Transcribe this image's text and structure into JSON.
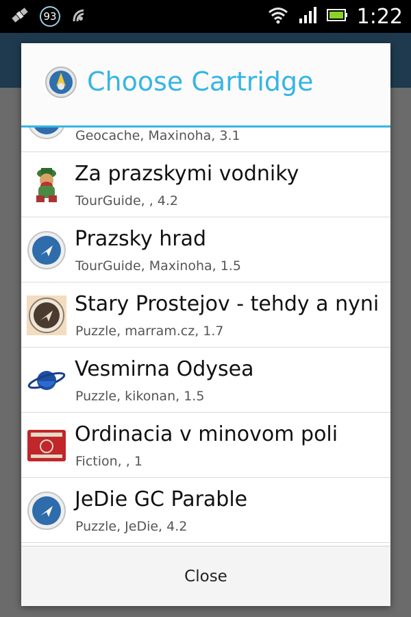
{
  "status_bar": {
    "battery_badge": "93",
    "time": "1:22"
  },
  "dialog": {
    "title": "Choose Cartridge",
    "close_label": "Close",
    "accent_color": "#35b5e5",
    "items": [
      {
        "title": "",
        "subtitle": "Geocache, Maxinoha, 3.1",
        "icon": "wherigo-compass-icon"
      },
      {
        "title": "Za prazskymi vodniky",
        "subtitle": "TourGuide, , 4.2",
        "icon": "water-goblin-icon"
      },
      {
        "title": "Prazsky hrad",
        "subtitle": "TourGuide, Maxinoha, 1.5",
        "icon": "wherigo-compass-icon"
      },
      {
        "title": "Stary Prostejov - tehdy a nyni",
        "subtitle": "Puzzle, marram.cz, 1.7",
        "icon": "sepia-compass-icon"
      },
      {
        "title": "Vesmirna Odysea",
        "subtitle": "Puzzle, kikonan, 1.5",
        "icon": "planet-icon"
      },
      {
        "title": "Ordinacia v minovom poli",
        "subtitle": "Fiction, , 1",
        "icon": "red-poster-icon"
      },
      {
        "title": "JeDie GC Parable",
        "subtitle": "Puzzle, JeDie, 4.2",
        "icon": "wherigo-compass-icon"
      }
    ]
  }
}
